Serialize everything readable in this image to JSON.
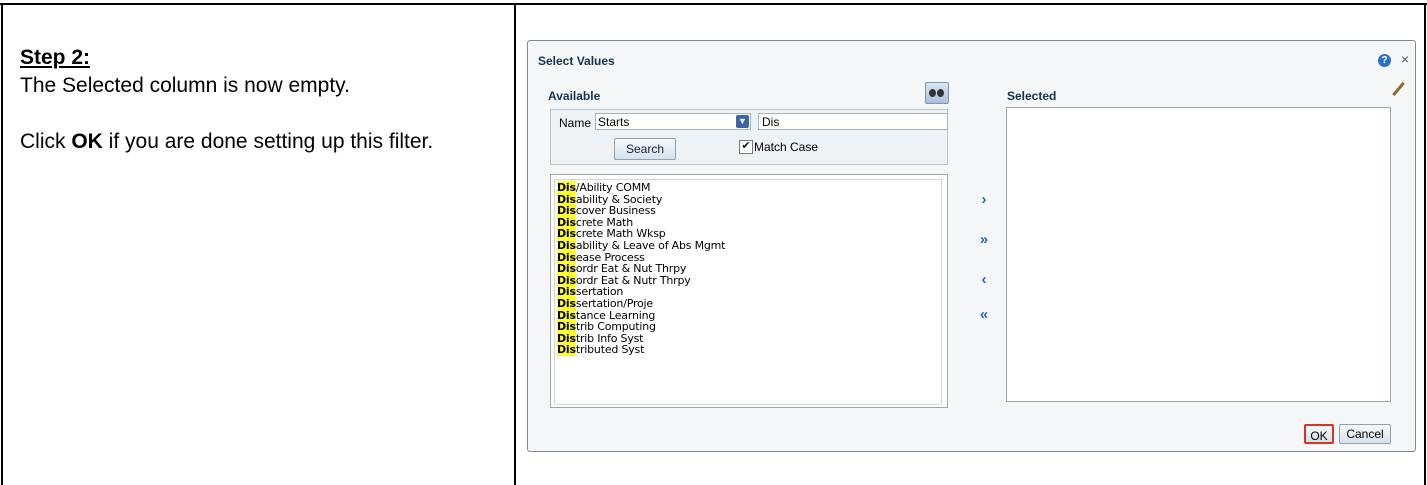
{
  "instructions": {
    "step_title": "Step 2:",
    "line1": "The Selected column is now empty.",
    "line2_prefix": "Click ",
    "line2_bold": "OK",
    "line2_suffix": " if you are done setting up this filter."
  },
  "dialog": {
    "title": "Select Values",
    "help_icon": "?",
    "close_icon": "×",
    "available_label": "Available",
    "selected_label": "Selected",
    "search": {
      "name_label": "Name",
      "operator": "Starts",
      "value": "Dis",
      "search_button": "Search",
      "match_case_label": "Match Case",
      "match_case_checked": true
    },
    "available_items": [
      {
        "hl": "Dis",
        "rest": "/Ability COMM"
      },
      {
        "hl": "Dis",
        "rest": "ability & Society"
      },
      {
        "hl": "Dis",
        "rest": "cover Business"
      },
      {
        "hl": "Dis",
        "rest": "crete Math"
      },
      {
        "hl": "Dis",
        "rest": "crete Math Wksp"
      },
      {
        "hl": "Dis",
        "rest": "ability & Leave of Abs Mgmt"
      },
      {
        "hl": "Dis",
        "rest": "ease Process"
      },
      {
        "hl": "Dis",
        "rest": "ordr Eat & Nut Thrpy"
      },
      {
        "hl": "Dis",
        "rest": "ordr Eat & Nutr Thrpy"
      },
      {
        "hl": "Dis",
        "rest": "sertation"
      },
      {
        "hl": "Dis",
        "rest": "sertation/Proje"
      },
      {
        "hl": "Dis",
        "rest": "tance Learning"
      },
      {
        "hl": "Dis",
        "rest": "trib Computing"
      },
      {
        "hl": "Dis",
        "rest": "trib Info Syst"
      },
      {
        "hl": "Dis",
        "rest": "tributed Syst"
      }
    ],
    "move_buttons": {
      "move": "›",
      "move_all": "»",
      "remove": "‹",
      "remove_all": "«"
    },
    "ok_button": "OK",
    "cancel_button": "Cancel"
  },
  "colors": {
    "highlight": "#ffff33",
    "ok_border": "#d8341f",
    "label_text": "#15324c"
  }
}
